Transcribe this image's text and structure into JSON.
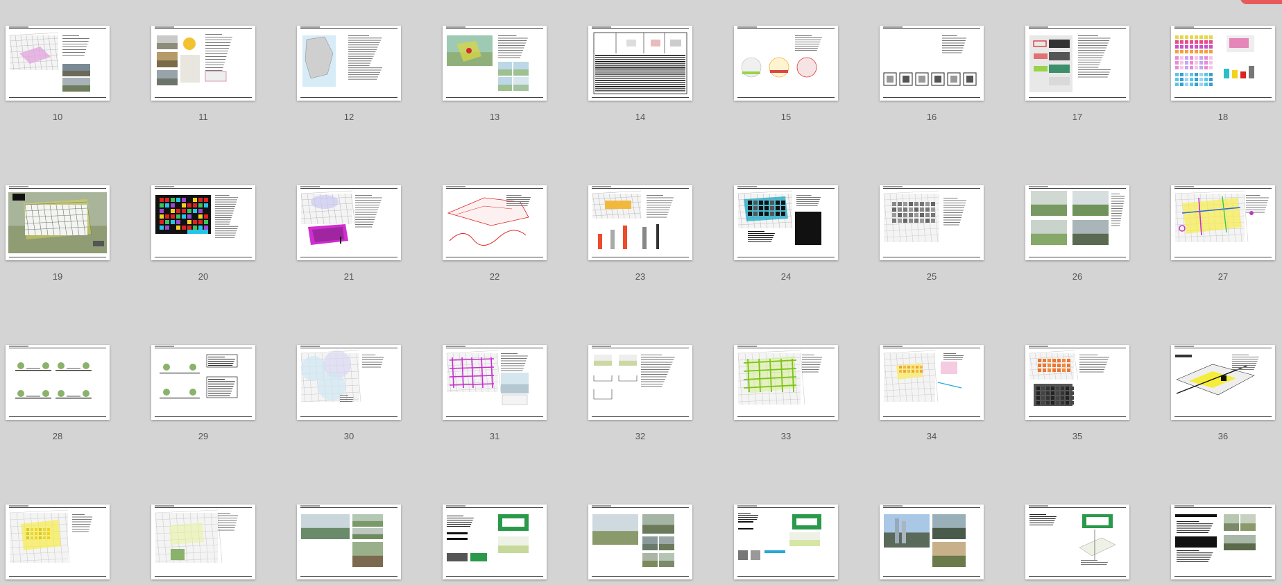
{
  "viewer": {
    "rows": [
      [
        {
          "page": "10",
          "art": "plan-text-photos"
        },
        {
          "page": "11",
          "art": "photos-text"
        },
        {
          "page": "12",
          "art": "blue-map-text"
        },
        {
          "page": "13",
          "art": "aerial-map"
        },
        {
          "page": "14",
          "art": "table"
        },
        {
          "page": "15",
          "art": "circle-diagrams"
        },
        {
          "page": "16",
          "art": "icon-row"
        },
        {
          "page": "17",
          "art": "colored-diagrams"
        },
        {
          "page": "18",
          "art": "color-blocks-chart"
        }
      ],
      [
        {
          "page": "19",
          "art": "green-aerial"
        },
        {
          "page": "20",
          "art": "black-color-plan"
        },
        {
          "page": "21",
          "art": "magenta-plan"
        },
        {
          "page": "22",
          "art": "red-sketch"
        },
        {
          "page": "23",
          "art": "axo-towers"
        },
        {
          "page": "24",
          "art": "cyan-plan-table"
        },
        {
          "page": "25",
          "art": "gray-blocks"
        },
        {
          "page": "26",
          "art": "four-renders"
        },
        {
          "page": "27",
          "art": "yellow-network"
        }
      ],
      [
        {
          "page": "28",
          "art": "sections"
        },
        {
          "page": "29",
          "art": "sections-table"
        },
        {
          "page": "30",
          "art": "circles-plan"
        },
        {
          "page": "31",
          "art": "magenta-grid"
        },
        {
          "page": "32",
          "art": "sketch-sections"
        },
        {
          "page": "33",
          "art": "green-grid"
        },
        {
          "page": "34",
          "art": "orange-plan"
        },
        {
          "page": "35",
          "art": "orange-blocks"
        },
        {
          "page": "36",
          "art": "yellow-axo"
        }
      ],
      [
        {
          "page": "37",
          "art": "yellow-plan"
        },
        {
          "page": "38",
          "art": "green-plan"
        },
        {
          "page": "39",
          "art": "photos-grid"
        },
        {
          "page": "40",
          "art": "green-section"
        },
        {
          "page": "41",
          "art": "street-photos"
        },
        {
          "page": "42",
          "art": "green-section-2"
        },
        {
          "page": "43",
          "art": "city-photos"
        },
        {
          "page": "44",
          "art": "green-axo"
        },
        {
          "page": "45",
          "art": "table-photos"
        }
      ]
    ]
  }
}
